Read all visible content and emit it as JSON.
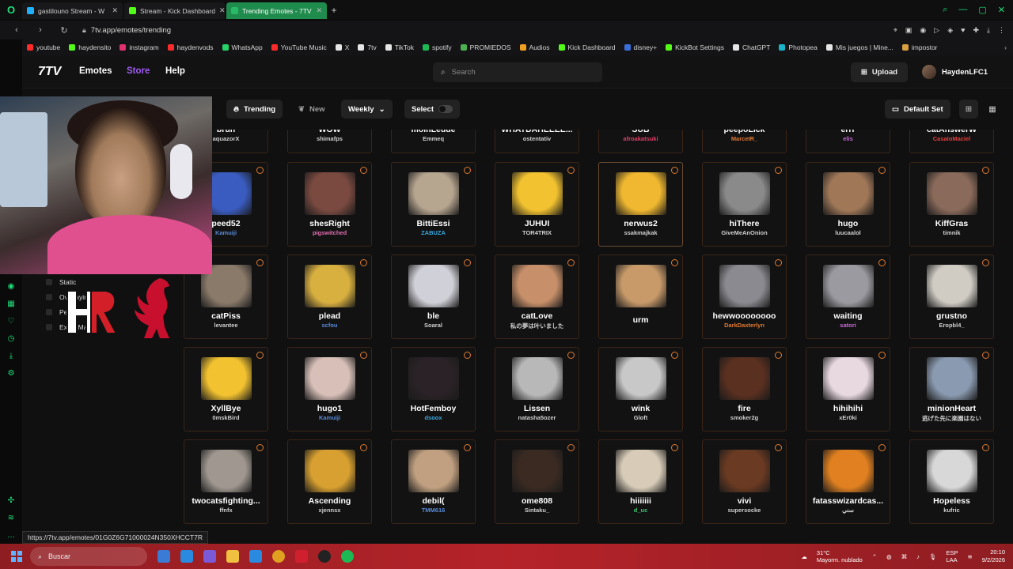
{
  "browser": {
    "tabs": [
      {
        "title": "gastilouno Stream - W",
        "color": "#1fb0ff",
        "active": false
      },
      {
        "title": "Stream - Kick Dashboard",
        "color": "#53fc18",
        "active": false
      },
      {
        "title": "Trending Emotes - 7TV",
        "color": "#29b866",
        "active": true
      }
    ],
    "new_tab": "+",
    "url": "7tv.app/emotes/trending",
    "bookmarks": [
      {
        "label": "youtube",
        "color": "#ff2a2a"
      },
      {
        "label": "haydensito",
        "color": "#53fc18"
      },
      {
        "label": "instagram",
        "color": "#e1306c"
      },
      {
        "label": "haydenvods",
        "color": "#ff2a2a"
      },
      {
        "label": "WhatsApp",
        "color": "#25d366"
      },
      {
        "label": "YouTube Music",
        "color": "#ff2a2a"
      },
      {
        "label": "X",
        "color": "#e6e6e6"
      },
      {
        "label": "7tv",
        "color": "#e6e6e6"
      },
      {
        "label": "TikTok",
        "color": "#e6e6e6"
      },
      {
        "label": "spotify",
        "color": "#1db954"
      },
      {
        "label": "PROMIEDOS",
        "color": "#4caf50"
      },
      {
        "label": "Audios",
        "color": "#f0a020"
      },
      {
        "label": "Kick Dashboard",
        "color": "#53fc18"
      },
      {
        "label": "disney+",
        "color": "#3a6fd8"
      },
      {
        "label": "KickBot Settings",
        "color": "#53fc18"
      },
      {
        "label": "ChatGPT",
        "color": "#e6e6e6"
      },
      {
        "label": "Photopea",
        "color": "#19b4c8"
      },
      {
        "label": "Mis juegos | Mine...",
        "color": "#e6e6e6"
      },
      {
        "label": "impostor",
        "color": "#d8a040"
      }
    ],
    "status_url": "https://7tv.app/emotes/01G0Z6G71000024N350XHCCT7R"
  },
  "site": {
    "logo": "7TV",
    "nav": {
      "emotes": "Emotes",
      "store": "Store",
      "help": "Help"
    },
    "search_placeholder": "Search",
    "upload": "Upload",
    "username": "HaydenLFC1"
  },
  "toolbar": {
    "trending": "Trending",
    "new": "New",
    "period": "Weekly",
    "select": "Select",
    "default_set": "Default Set"
  },
  "filters": [
    "Static",
    "Overlaying",
    "Personal",
    "Exact Match"
  ],
  "filter_visible_text": [
    "Static",
    "Overla",
    "P",
    "Exa",
    "tch"
  ],
  "emote_rows": [
    [
      {
        "name": "bruh",
        "owner": "aquazorX",
        "owner_color": "#cfcfcf",
        "img": "none"
      },
      {
        "name": "WOW",
        "owner": "shimafps",
        "owner_color": "#cfcfcf",
        "img": "none"
      },
      {
        "name": "moinLeude",
        "owner": "Emmeq",
        "owner_color": "#cfcfcf",
        "img": "none"
      },
      {
        "name": "WHATDAHEEEE...",
        "owner": "ostentativ",
        "owner_color": "#cfcfcf",
        "img": "none"
      },
      {
        "name": "SUB",
        "owner": "afroakatsuki",
        "owner_color": "#e0406a",
        "img": "none"
      },
      {
        "name": "peepoLick",
        "owner": "MarceIR_",
        "owner_color": "#e07a30",
        "img": "none"
      },
      {
        "name": "errr",
        "owner": "elis",
        "owner_color": "#c86ad8",
        "img": "none"
      },
      {
        "name": "catAnswerW",
        "owner": "CasaIoMaciel",
        "owner_color": "#e04040",
        "img": "none"
      }
    ],
    [
      {
        "name": "peed52",
        "owner": "Kamuiji",
        "owner_color": "#5a8ad8",
        "img": "#3a5cc0"
      },
      {
        "name": "shesRight",
        "owner": "pigswitched",
        "owner_color": "#e070b0",
        "img": "#7a4a40"
      },
      {
        "name": "BittiEssi",
        "owner": "ZABUZA",
        "owner_color": "#3aa8e0",
        "img": "#b6a58f"
      },
      {
        "name": "JUHUI",
        "owner": "TOR4TRIX",
        "owner_color": "#cfcfcf",
        "img": "#f2c230"
      },
      {
        "name": "nerwus2",
        "owner": "ssakmajkak",
        "owner_color": "#cfcfcf",
        "img": "#f0b830"
      },
      {
        "name": "hiThere",
        "owner": "GiveMeAnOnion",
        "owner_color": "#cfcfcf",
        "img": "#8a8a8a"
      },
      {
        "name": "hugo",
        "owner": "luucaalol",
        "owner_color": "#cfcfcf",
        "img": "#a07858"
      },
      {
        "name": "KiffGras",
        "owner": "timnik",
        "owner_color": "#cfcfcf",
        "img": "#8a6a5a"
      }
    ],
    [
      {
        "name": "catPiss",
        "owner": "levantee",
        "owner_color": "#cfcfcf",
        "img": "#8a7a6a"
      },
      {
        "name": "plead",
        "owner": "scfou",
        "owner_color": "#5a8ad8",
        "img": "#d8b040"
      },
      {
        "name": "ble",
        "owner": "Soaral",
        "owner_color": "#cfcfcf",
        "img": "#d0d0d8"
      },
      {
        "name": "catLove",
        "owner": "私の夢は叶いました",
        "owner_color": "#cfcfcf",
        "img": "#c8906a"
      },
      {
        "name": "urm",
        "owner": "",
        "owner_color": "#cfcfcf",
        "img": "#c89a6a"
      },
      {
        "name": "hewwoooooooo",
        "owner": "DarkDaxterlyn",
        "owner_color": "#e07a30",
        "img": "#8a8a90"
      },
      {
        "name": "waiting",
        "owner": "satori",
        "owner_color": "#c86ad8",
        "img": "#9a9aa0"
      },
      {
        "name": "grustno",
        "owner": "Eropbl4_",
        "owner_color": "#cfcfcf",
        "img": "#d0ccc4"
      }
    ],
    [
      {
        "name": "XyllBye",
        "owner": "0mskBird",
        "owner_color": "#cfcfcf",
        "img": "#f2c230"
      },
      {
        "name": "hugo1",
        "owner": "Kamuiji",
        "owner_color": "#5a8ad8",
        "img": "#d8c0b8"
      },
      {
        "name": "HotFemboy",
        "owner": "dsoox",
        "owner_color": "#3aa8e0",
        "img": "#2a2226"
      },
      {
        "name": "Lissen",
        "owner": "natasha5ozer",
        "owner_color": "#cfcfcf",
        "img": "#b8b8b8"
      },
      {
        "name": "wink",
        "owner": "Gloft",
        "owner_color": "#cfcfcf",
        "img": "#c8c8c8"
      },
      {
        "name": "fire",
        "owner": "smoker2g",
        "owner_color": "#cfcfcf",
        "img": "#5a3020"
      },
      {
        "name": "hihihihi",
        "owner": "xEr0ki",
        "owner_color": "#cfcfcf",
        "img": "#e8d8e0"
      },
      {
        "name": "minionHeart",
        "owner": "逃げた先に楽園はない",
        "owner_color": "#cfcfcf",
        "img": "#8a9ab0"
      }
    ],
    [
      {
        "name": "twocatsfighting...",
        "owner": "ffnfx",
        "owner_color": "#cfcfcf",
        "img": "#a09890"
      },
      {
        "name": "Ascending",
        "owner": "xjennsx",
        "owner_color": "#cfcfcf",
        "img": "#d8a030"
      },
      {
        "name": "debil(",
        "owner": "TMM616",
        "owner_color": "#5a8ad8",
        "img": "#c0a080"
      },
      {
        "name": "ome808",
        "owner": "Sintaku_",
        "owner_color": "#cfcfcf",
        "img": "#3a2a22"
      },
      {
        "name": "hiiiiiii",
        "owner": "d_uc",
        "owner_color": "#3ac870",
        "img": "#d8ccb8"
      },
      {
        "name": "vivi",
        "owner": "supersocke",
        "owner_color": "#cfcfcf",
        "img": "#6a3a22"
      },
      {
        "name": "fatasswizardcas...",
        "owner": "ﺳﻨﻲ",
        "owner_color": "#cfcfcf",
        "img": "#e08020"
      },
      {
        "name": "Hopeless",
        "owner": "kufric",
        "owner_color": "#cfcfcf",
        "img": "#d8d8d8"
      }
    ]
  ],
  "taskbar": {
    "search": "Buscar",
    "weather_temp": "31°C",
    "weather_desc": "Mayorm. nublado",
    "lang_top": "ESP",
    "lang_bottom": "LAA",
    "time": "20:10",
    "date": "9/2/2026"
  },
  "colors": {
    "accent": "#a15cf5",
    "card_border": "#3a2418",
    "taskbar": "#b52329",
    "gx_green": "#1ee07a"
  }
}
